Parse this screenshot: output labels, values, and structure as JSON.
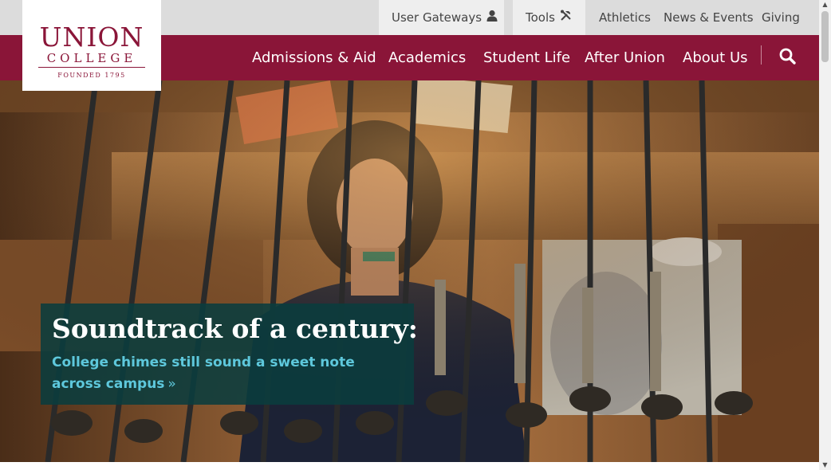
{
  "utility": {
    "user_gateways": "User Gateways",
    "tools": "Tools",
    "athletics": "Athletics",
    "news_events": "News & Events",
    "giving": "Giving",
    "user_icon": "user-icon",
    "tools_icon": "tools-icon"
  },
  "logo": {
    "union": "UNION",
    "college": "COLLEGE",
    "founded": "FOUNDED 1795"
  },
  "nav": {
    "items": [
      "Admissions & Aid",
      "Academics",
      "Student Life",
      "After Union",
      "About Us"
    ],
    "search_icon": "search-icon"
  },
  "hero": {
    "title": "Soundtrack of a century:",
    "link": "College chimes still sound a sweet note across campus",
    "link_chevron": "»"
  },
  "colors": {
    "brand": "#8a1538",
    "caption_bg": "#0a3c3e",
    "link": "#5ec8dc"
  }
}
